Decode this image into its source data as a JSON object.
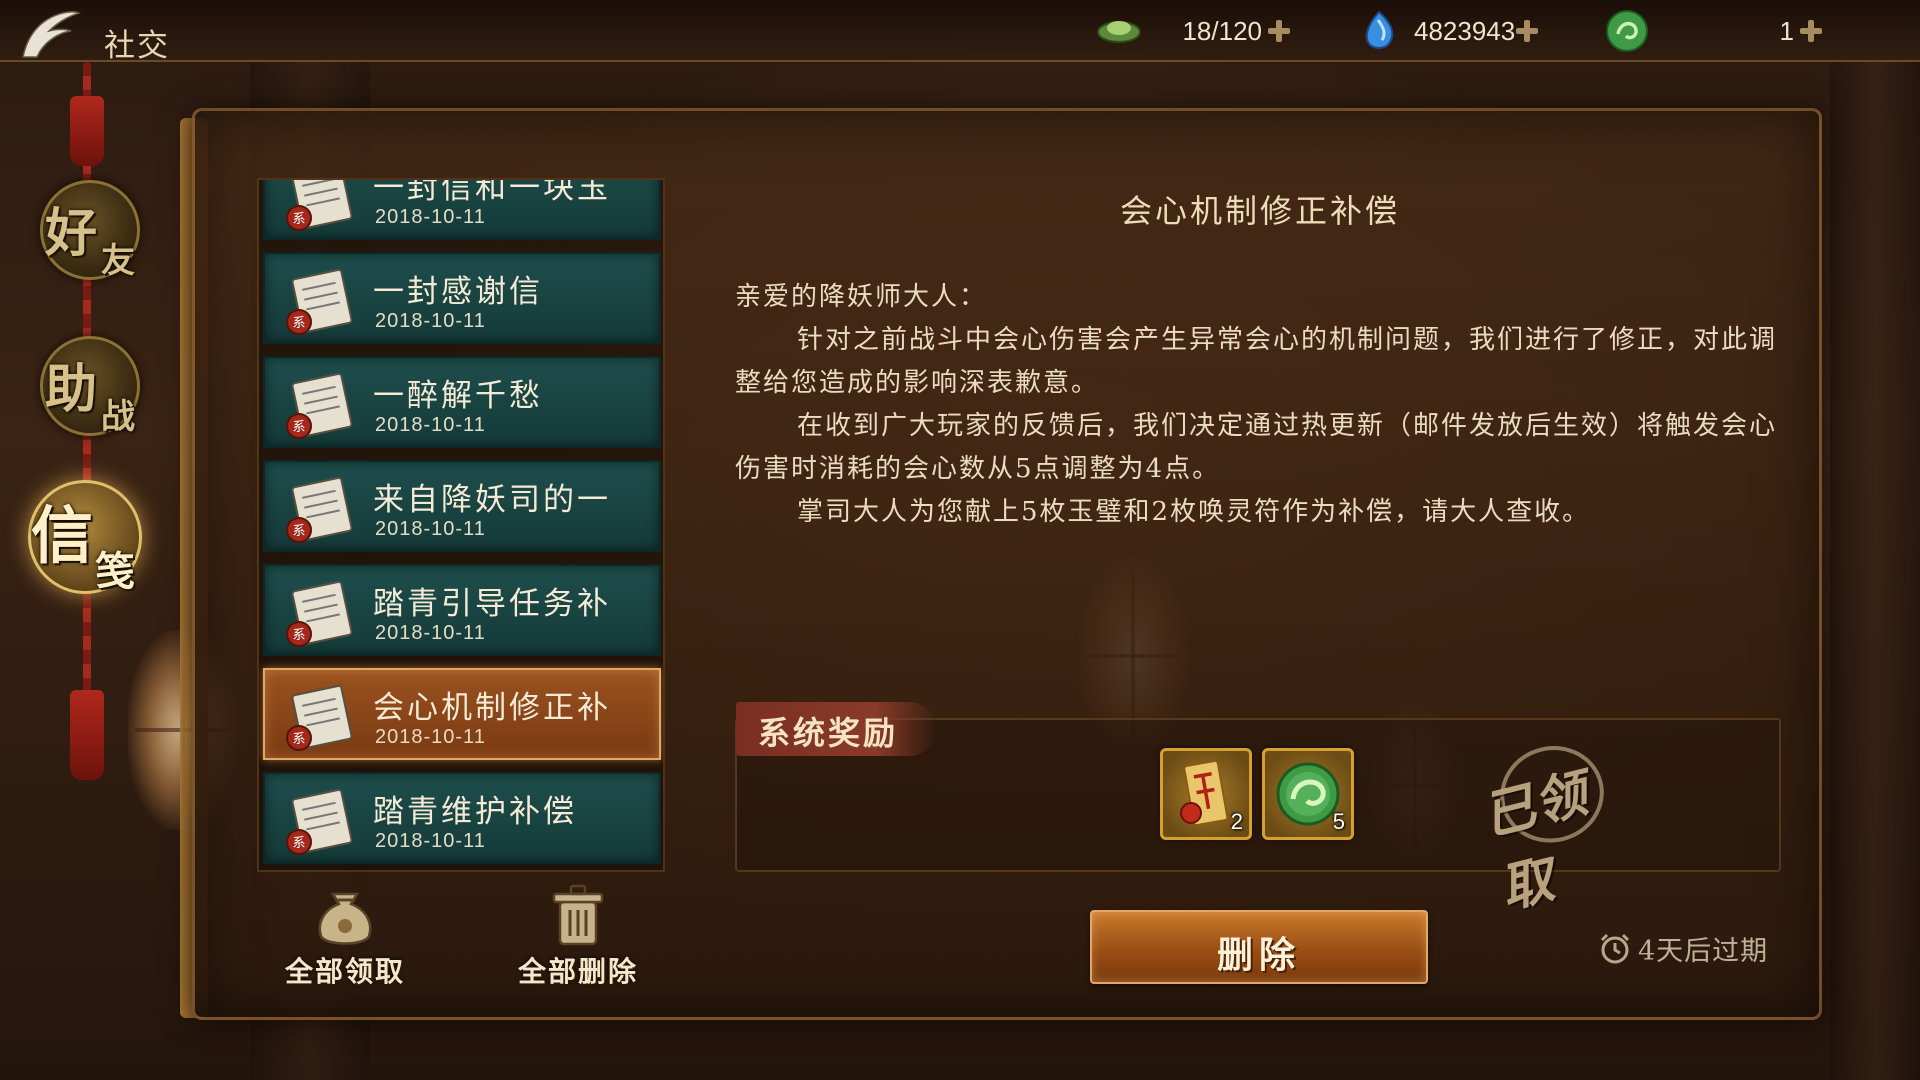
{
  "header": {
    "title": "社交",
    "resources": [
      {
        "icon": "jade-leaf-icon",
        "value": "18/120"
      },
      {
        "icon": "blue-crystal-icon",
        "value": "4823943"
      },
      {
        "icon": "green-jade-disc-icon",
        "value": "1"
      }
    ]
  },
  "nav": {
    "tabs": [
      {
        "c1": "好",
        "c2": "友",
        "active": false
      },
      {
        "c1": "助",
        "c2": "战",
        "active": false
      },
      {
        "c1": "信",
        "c2": "笺",
        "active": true
      }
    ]
  },
  "mail_list": {
    "items": [
      {
        "title": "一封信和一块玉",
        "date": "2018-10-11",
        "tag": "系",
        "selected": false
      },
      {
        "title": "一封感谢信",
        "date": "2018-10-11",
        "tag": "系",
        "selected": false
      },
      {
        "title": "一醉解千愁",
        "date": "2018-10-11",
        "tag": "系",
        "selected": false
      },
      {
        "title": "来自降妖司的一",
        "date": "2018-10-11",
        "tag": "系",
        "selected": false
      },
      {
        "title": "踏青引导任务补",
        "date": "2018-10-11",
        "tag": "系",
        "selected": false
      },
      {
        "title": "会心机制修正补",
        "date": "2018-10-11",
        "tag": "系",
        "selected": true
      },
      {
        "title": "踏青维护补偿",
        "date": "2018-10-11",
        "tag": "系",
        "selected": false
      }
    ]
  },
  "actions": {
    "claim_all": "全部领取",
    "delete_all": "全部删除",
    "delete": "删除"
  },
  "mail": {
    "title": "会心机制修正补偿",
    "greeting": "亲爱的降妖师大人：",
    "paragraphs": [
      "针对之前战斗中会心伤害会产生异常会心的机制问题，我们进行了修正，对此调整给您造成的影响深表歉意。",
      "在收到广大玩家的反馈后，我们决定通过热更新（邮件发放后生效）将触发会心伤害时消耗的会心数从5点调整为4点。",
      "掌司大人为您献上5枚玉璧和2枚唤灵符作为补偿，请大人查收。"
    ],
    "reward_label": "系统奖励",
    "rewards": [
      {
        "icon": "summon-talisman-icon",
        "count": "2"
      },
      {
        "icon": "jade-disc-icon",
        "count": "5"
      }
    ],
    "claimed_stamp": "已领取",
    "expire_text": "4天后过期"
  },
  "colors": {
    "list_item": "#1e4e4c",
    "list_selected": "#9a5220",
    "button": "#b0621e",
    "text": "#eadcc0"
  }
}
